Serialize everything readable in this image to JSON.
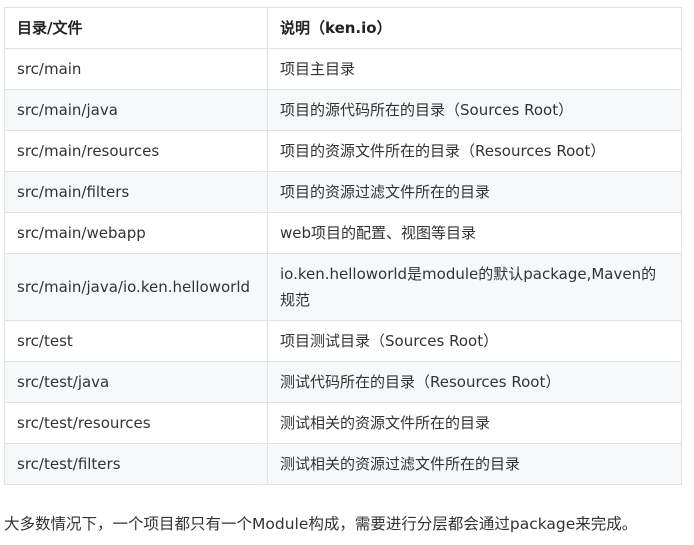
{
  "table": {
    "headers": [
      "目录/文件",
      "说明（ken.io）"
    ],
    "rows": [
      [
        "src/main",
        "项目主目录"
      ],
      [
        "src/main/java",
        "项目的源代码所在的目录（Sources Root）"
      ],
      [
        "src/main/resources",
        "项目的资源文件所在的目录（Resources Root）"
      ],
      [
        "src/main/filters",
        "项目的资源过滤文件所在的目录"
      ],
      [
        "src/main/webapp",
        "web项目的配置、视图等目录"
      ],
      [
        "src/main/java/io.ken.helloworld",
        "io.ken.helloworld是module的默认package,Maven的规范"
      ],
      [
        "src/test",
        "项目测试目录（Sources Root）"
      ],
      [
        "src/test/java",
        "测试代码所在的目录（Resources Root）"
      ],
      [
        "src/test/resources",
        "测试相关的资源文件所在的目录"
      ],
      [
        "src/test/filters",
        "测试相关的资源过滤文件所在的目录"
      ]
    ]
  },
  "paragraph": "大多数情况下，一个项目都只有一个Module构成，需要进行分层都会通过package来完成。",
  "colors": {
    "border": "#dfe2e5",
    "stripe": "#f6f8fa",
    "text": "#333333"
  }
}
